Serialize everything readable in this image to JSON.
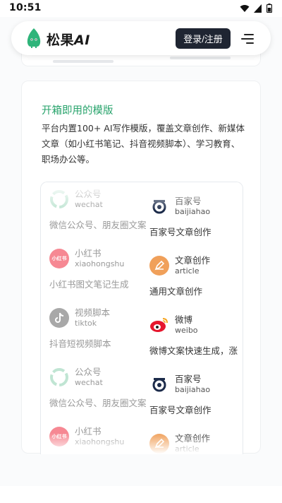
{
  "status_bar": {
    "time": "10:51"
  },
  "header": {
    "brand_name": "松果",
    "brand_suffix": "AI",
    "login_label": "登录/注册",
    "brand_color": "#27a36b"
  },
  "section": {
    "title": "开箱即用的模版",
    "description": "平台内置100+ AI写作模版，覆盖文章创作、新媒体文章（如小红书笔记、抖音视频脚本）、学习教育、职场办公等。"
  },
  "templates_left": [
    {
      "name": "公众号",
      "code": "wechat",
      "desc": "微信公众号、朋友圈文案",
      "icon": "wechat-icon"
    },
    {
      "name": "小红书",
      "code": "xiaohongshu",
      "desc": "小红书图文笔记生成",
      "icon": "xiaohongshu-icon",
      "icon_text": "小红书"
    },
    {
      "name": "视频脚本",
      "code": "tiktok",
      "desc": "抖音短视频脚本",
      "icon": "tiktok-icon"
    },
    {
      "name": "公众号",
      "code": "wechat",
      "desc": "微信公众号、朋友圈文案",
      "icon": "wechat-icon"
    },
    {
      "name": "小红书",
      "code": "xiaohongshu",
      "desc": "",
      "icon": "xiaohongshu-icon",
      "icon_text": "小红书"
    }
  ],
  "templates_right": [
    {
      "name": "百家号",
      "code": "baijiahao",
      "desc": "百家号文章创作",
      "icon": "baijiahao-icon"
    },
    {
      "name": "文章创作",
      "code": "article",
      "desc": "通用文章创作",
      "icon": "article-pen-icon"
    },
    {
      "name": "微博",
      "code": "weibo",
      "desc": "微博文案快速生成，涨",
      "icon": "weibo-icon"
    },
    {
      "name": "百家号",
      "code": "baijiahao",
      "desc": "百家号文章创作",
      "icon": "baijiahao-icon"
    },
    {
      "name": "文章创作",
      "code": "article",
      "desc": "",
      "icon": "article-pen-icon"
    }
  ]
}
